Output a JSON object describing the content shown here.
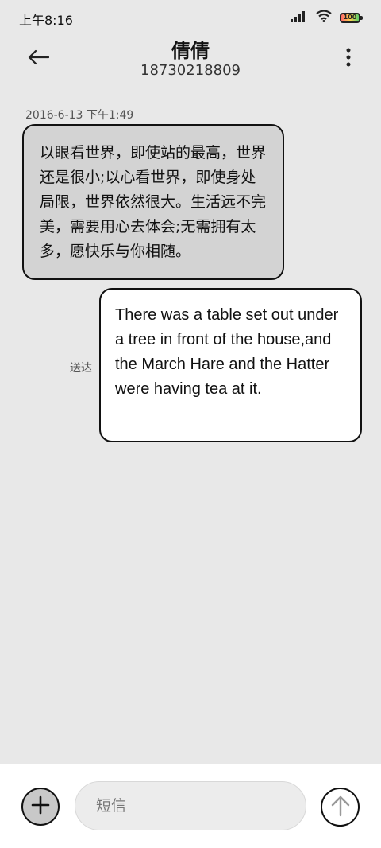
{
  "status_bar": {
    "time": "上午8:16",
    "battery_level": "100",
    "icons": [
      "signal-icon",
      "wifi-icon",
      "battery-icon"
    ]
  },
  "header": {
    "contact_name": "倩倩",
    "phone_number": "18730218809",
    "icons": [
      "back-arrow-icon",
      "more-vertical-icon"
    ]
  },
  "messages": [
    {
      "direction": "incoming",
      "timestamp": "2016-6-13 下午1:49",
      "text": "以眼看世界，即使站的最高，世界还是很小;以心看世界，即使身处局限，世界依然很大。生活远不完美，需要用心去体会;无需拥有太多，愿快乐与你相随。"
    },
    {
      "direction": "outgoing",
      "status": "送达",
      "text": "There was a table set out under a tree in front of the house,and the March Hare and the Hatter were having tea at it."
    }
  ],
  "composer": {
    "placeholder": "短信",
    "value": "",
    "icons": [
      "plus-icon",
      "send-arrow-up-icon"
    ]
  }
}
